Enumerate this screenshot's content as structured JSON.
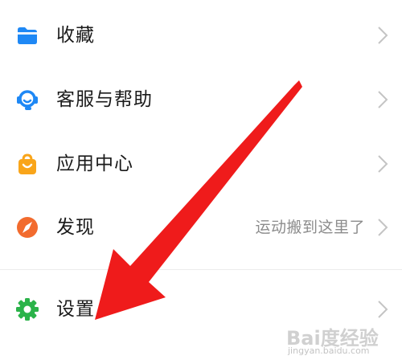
{
  "menu": {
    "items": [
      {
        "label": "收藏",
        "hint": "",
        "icon": "folder-icon",
        "color": "#1e88f5"
      },
      {
        "label": "客服与帮助",
        "hint": "",
        "icon": "headset-icon",
        "color": "#1e88f5"
      },
      {
        "label": "应用中心",
        "hint": "",
        "icon": "shopping-bag-icon",
        "color": "#f9a51a"
      },
      {
        "label": "发现",
        "hint": "运动搬到这里了",
        "icon": "compass-icon",
        "color": "#f26b2e"
      },
      {
        "label": "设置",
        "hint": "",
        "icon": "gear-icon",
        "color": "#2bb34a"
      }
    ]
  },
  "annotation": {
    "icon": "red-arrow-icon",
    "color": "#ef1b1b"
  },
  "watermark": {
    "text": "Bai度经验",
    "sub": "jingyan.baidu.com"
  }
}
